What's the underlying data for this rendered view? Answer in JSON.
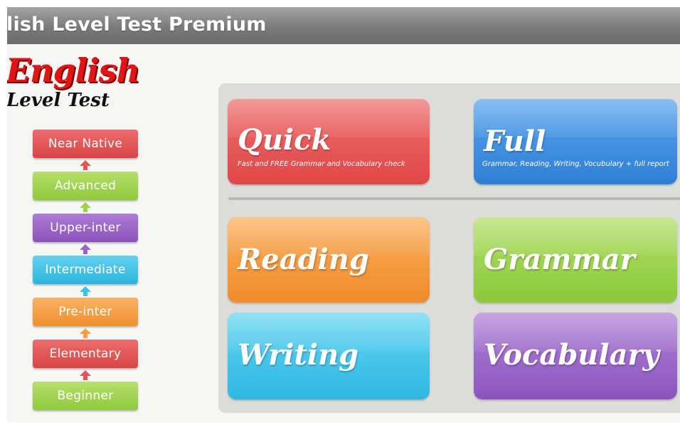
{
  "window": {
    "title": "lish Level Test Premium"
  },
  "logo": {
    "line1": "English",
    "line2": "Level Test"
  },
  "levels": [
    {
      "label": "Near Native",
      "color": "#e35557"
    },
    {
      "label": "Advanced",
      "color": "#9fd44e"
    },
    {
      "label": "Upper-inter",
      "color": "#9a63c7"
    },
    {
      "label": "Intermediate",
      "color": "#3fc3e5"
    },
    {
      "label": "Pre-inter",
      "color": "#f7a043"
    },
    {
      "label": "Elementary",
      "color": "#e35557"
    },
    {
      "label": "Beginner",
      "color": "#9fd44e"
    }
  ],
  "tests": {
    "quick": {
      "title": "Quick",
      "subtitle": "Fast and FREE Grammar and Vocabulary check",
      "color": "#e8504f"
    },
    "full": {
      "title": "Full",
      "subtitle": "Grammar, Reading, Writing, Vocubulary + full report",
      "color": "#3f8fdf"
    },
    "reading": {
      "title": "Reading",
      "color": "#f59a3a"
    },
    "grammar": {
      "title": "Grammar",
      "color": "#98d34a"
    },
    "writing": {
      "title": "Writing",
      "color": "#3ec4ea"
    },
    "vocabulary": {
      "title": "Vocabulary",
      "color": "#9b66c9"
    }
  }
}
